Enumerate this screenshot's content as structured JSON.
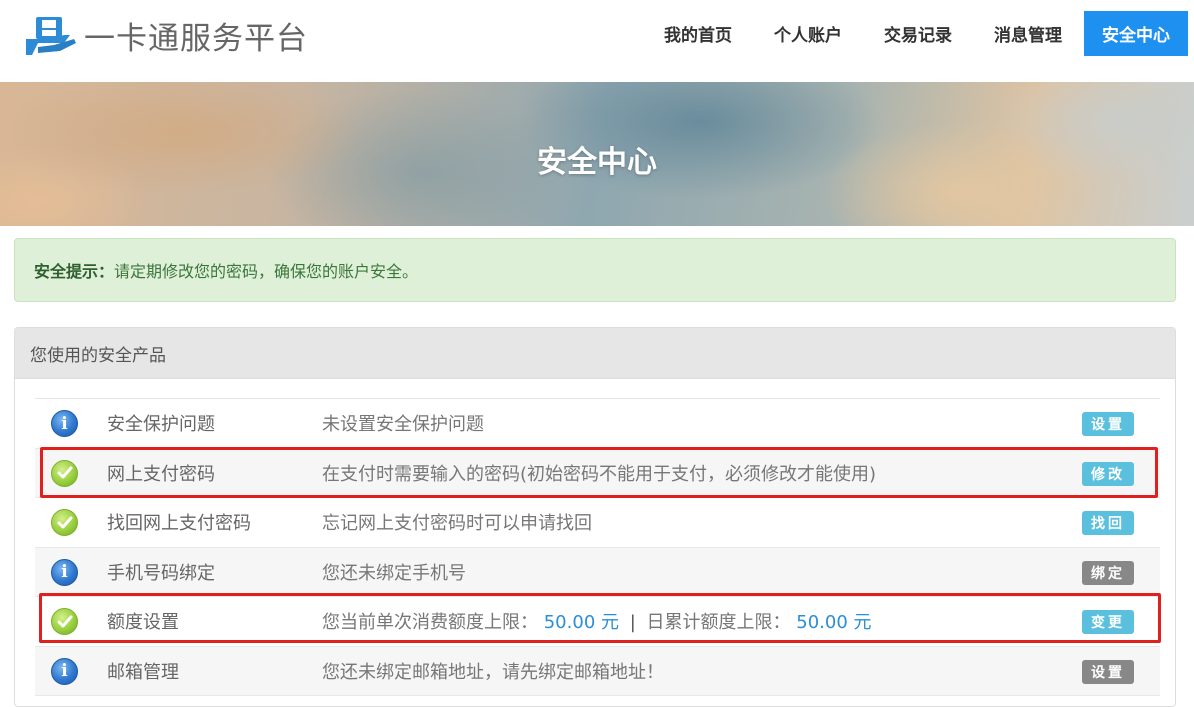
{
  "header": {
    "logo_text": "一卡通服务平台",
    "nav": [
      {
        "label": "我的首页",
        "active": false
      },
      {
        "label": "个人账户",
        "active": false
      },
      {
        "label": "交易记录",
        "active": false
      },
      {
        "label": "消息管理",
        "active": false
      },
      {
        "label": "安全中心",
        "active": true
      }
    ]
  },
  "banner": {
    "title": "安全中心"
  },
  "alert": {
    "label": "安全提示：",
    "text": "请定期修改您的密码，确保您的账户安全。"
  },
  "panel": {
    "heading": "您使用的安全产品",
    "rows": [
      {
        "status": "info",
        "name": "安全保护问题",
        "desc": "未设置安全保护问题",
        "action": "设置",
        "action_color": "blue"
      },
      {
        "status": "ok",
        "name": "网上支付密码",
        "desc": "在支付时需要输入的密码(初始密码不能用于支付，必须修改才能使用)",
        "action": "修改",
        "action_color": "blue"
      },
      {
        "status": "ok",
        "name": "找回网上支付密码",
        "desc": "忘记网上支付密码时可以申请找回",
        "action": "找回",
        "action_color": "blue"
      },
      {
        "status": "info",
        "name": "手机号码绑定",
        "desc": "您还未绑定手机号",
        "action": "绑定",
        "action_color": "gray"
      },
      {
        "status": "ok",
        "name": "额度设置",
        "desc_prefix": "您当前单次消费额度上限：",
        "single_limit": "50.00 元",
        "separator": "|",
        "desc_middle": "日累计额度上限：",
        "daily_limit": "50.00 元",
        "action": "变更",
        "action_color": "blue"
      },
      {
        "status": "info",
        "name": "邮箱管理",
        "desc": "您还未绑定邮箱地址，请先绑定邮箱地址！",
        "action": "设置",
        "action_color": "gray"
      }
    ]
  },
  "colors": {
    "nav_active": "#1e90f0",
    "alert_bg": "#dff0d8",
    "button_blue": "#5bc0de",
    "button_gray": "#888888",
    "amount": "#2a8fd6",
    "highlight": "#e0201c"
  },
  "icons": {
    "info": "info-circle-icon",
    "ok": "check-circle-icon"
  }
}
